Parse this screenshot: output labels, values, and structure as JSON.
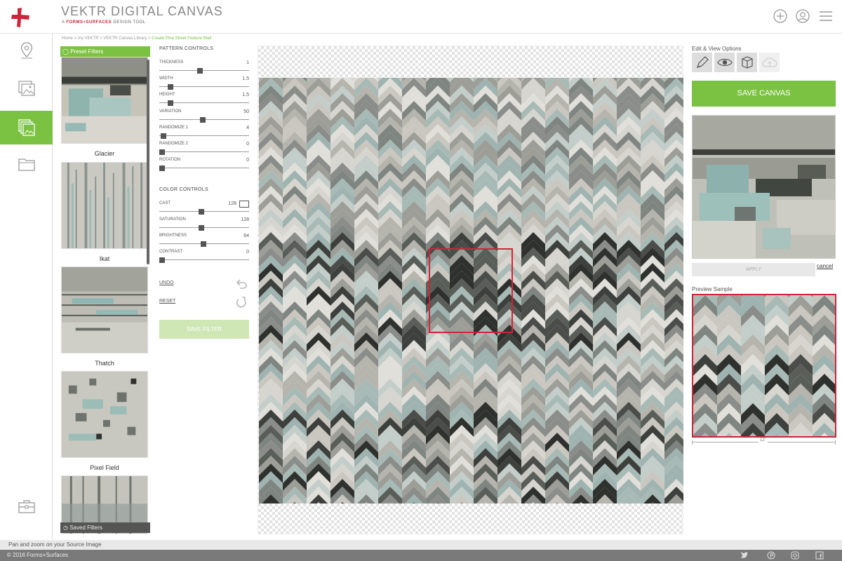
{
  "header": {
    "title": "VEKTR DIGITAL CANVAS",
    "subtitle_prefix": "A ",
    "subtitle_brand": "FORMS+SURFACES",
    "subtitle_suffix": " DESIGN TOOL"
  },
  "breadcrumb": {
    "items": [
      "Home",
      "my VEKTR",
      "VEKTR Canvas Library"
    ],
    "separator": " > ",
    "current": "Create Pine Street Feature Wall"
  },
  "filters": {
    "header": "Preset Filters",
    "items": [
      {
        "label": "Glacier"
      },
      {
        "label": "Ikat"
      },
      {
        "label": "Thatch"
      },
      {
        "label": "Pixel Field"
      },
      {
        "label": ""
      }
    ],
    "saved_label": "Saved Filters"
  },
  "pattern_controls": {
    "title": "PATTERN CONTROLS",
    "sliders": [
      {
        "label": "THICKNESS",
        "value": "1",
        "fraction": 0.45
      },
      {
        "label": "WIDTH",
        "value": "1.5",
        "fraction": 0.1
      },
      {
        "label": "HEIGHT",
        "value": "1.5",
        "fraction": 0.1
      },
      {
        "label": "VARIATION",
        "value": "50",
        "fraction": 0.48
      },
      {
        "label": "RANDOMIZE 1",
        "value": "4",
        "fraction": 0.02
      },
      {
        "label": "RANDOMIZE 2",
        "value": "0",
        "fraction": 0
      },
      {
        "label": "ROTATION",
        "value": "0",
        "fraction": 0
      }
    ]
  },
  "color_controls": {
    "title": "COLOR CONTROLS",
    "sliders": [
      {
        "label": "CAST",
        "value": "128",
        "fraction": 0.47
      },
      {
        "label": "SATURATION",
        "value": "128",
        "fraction": 0.47
      },
      {
        "label": "BRIGHTNESS",
        "value": "64",
        "fraction": 0.49
      },
      {
        "label": "CONTRAST",
        "value": "0",
        "fraction": 0
      }
    ]
  },
  "actions": {
    "undo": "UNDO",
    "reset": "RESET",
    "save_filter": "SAVE FILTER"
  },
  "edit_options": {
    "title": "Edit & View Options",
    "buttons": [
      "pencil-icon",
      "eye-icon",
      "cube-icon",
      "cloud-icon"
    ]
  },
  "save_canvas": "SAVE CANVAS",
  "source": {
    "apply": "APPLY",
    "cancel": "cancel"
  },
  "preview": {
    "title": "Preview Sample",
    "ruler_label": "12\""
  },
  "status_text": "Pan and zoom on your Source Image",
  "footer": {
    "copyright": "© 2016 Forms+Surfaces",
    "social": [
      "twitter-icon",
      "pinterest-icon",
      "instagram-icon",
      "facebook-icon"
    ]
  },
  "colors": {
    "accent": "#7cc242",
    "brand_red": "#d0243a"
  }
}
